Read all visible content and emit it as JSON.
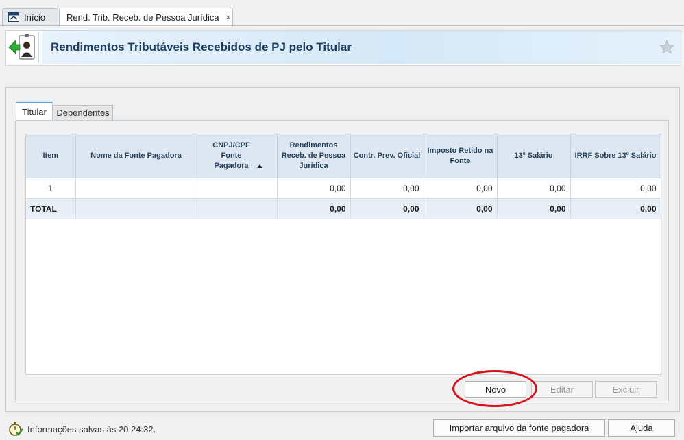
{
  "tabs": {
    "home": "Início",
    "active": "Rend. Trib. Receb. de Pessoa Jurídica",
    "close_glyph": "×"
  },
  "header": {
    "title": "Rendimentos Tributáveis Recebidos de PJ pelo Titular",
    "icon": "person-arrow-icon",
    "favorite_icon": "star-icon"
  },
  "inner_tabs": [
    "Titular",
    "Dependentes"
  ],
  "table": {
    "columns": [
      "Item",
      "Nome da Fonte Pagadora",
      "CNPJ/CPF Fonte Pagadora",
      "Rendimentos Receb. de Pessoa Jurídica",
      "Contr. Prev. Oficial",
      "Imposto Retido na Fonte",
      "13º Salário",
      "IRRF Sobre 13º Salário"
    ],
    "rows": [
      [
        "1",
        "",
        "",
        "0,00",
        "0,00",
        "0,00",
        "0,00",
        "0,00"
      ]
    ],
    "total": [
      "TOTAL",
      "",
      "",
      "0,00",
      "0,00",
      "0,00",
      "0,00",
      "0,00"
    ]
  },
  "actions": {
    "novo": "Novo",
    "editar": "Editar",
    "excluir": "Excluir"
  },
  "footer": {
    "status": "Informações salvas às 20:24:32.",
    "import": "Importar arquivo da fonte pagadora",
    "help": "Ajuda"
  },
  "colors": {
    "header_title": "#1c3e66",
    "highlight": "#d9121b"
  }
}
